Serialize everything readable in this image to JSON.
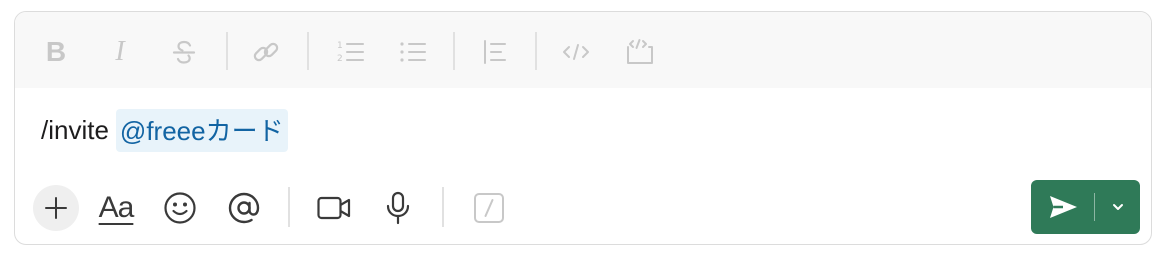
{
  "composer": {
    "message": {
      "command": "/invite",
      "mention": "@freeeカード"
    },
    "formatting_toolbar": {
      "bold_label": "B",
      "italic_label": "I",
      "icons": [
        "bold-icon",
        "italic-icon",
        "strikethrough-icon",
        "link-icon",
        "ordered-list-icon",
        "bulleted-list-icon",
        "blockquote-icon",
        "code-icon",
        "code-block-icon"
      ]
    },
    "actions": {
      "text_format_label": "Aa",
      "icons": [
        "plus-icon",
        "text-format-icon",
        "emoji-icon",
        "mention-icon",
        "video-icon",
        "microphone-icon",
        "slash-command-icon"
      ]
    },
    "send": {
      "icons": [
        "send-icon",
        "chevron-down-icon"
      ]
    }
  },
  "colors": {
    "send_bg": "#2f7a58",
    "mention_bg": "#e8f3fa",
    "mention_text": "#1264a3",
    "toolbar_bg": "#f8f8f8"
  }
}
